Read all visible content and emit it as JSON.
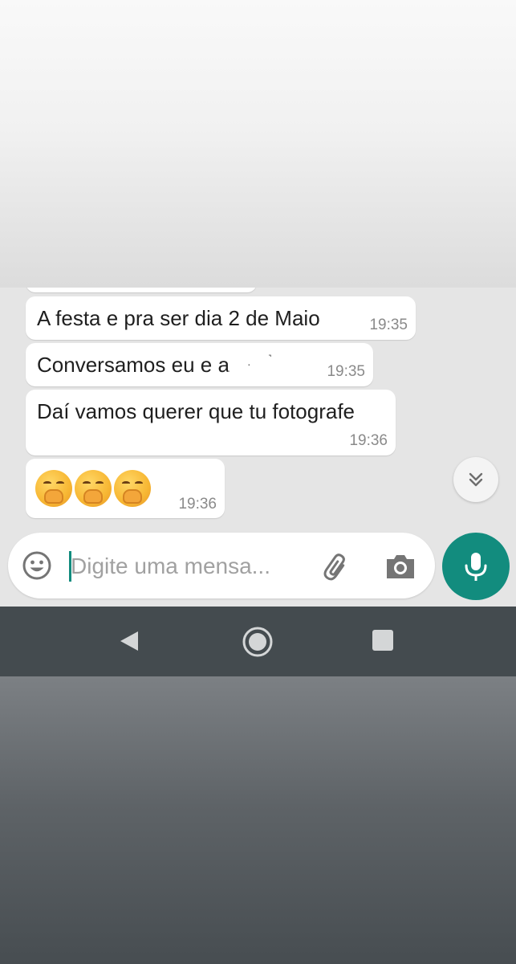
{
  "messages": [
    {
      "text": "A festa e pra ser dia 2 de Maio",
      "time": "19:35"
    },
    {
      "text": "Conversamos eu e a",
      "time": "19:35"
    },
    {
      "text": "Daí vamos querer que tu fotografe",
      "time": "19:36"
    },
    {
      "content": "shushing-face emoji ×3",
      "time": "19:36"
    }
  ],
  "input": {
    "placeholder": "Digite uma mensa..."
  },
  "icons": {
    "emoji": "smiley-icon",
    "attach": "paperclip-icon",
    "camera": "camera-icon",
    "mic": "microphone-icon",
    "scroll": "double-chevron-down-icon",
    "nav_back": "triangle-back-icon",
    "nav_home": "circle-home-icon",
    "nav_recent": "square-recent-icon"
  },
  "colors": {
    "accent": "#128c7e",
    "chat_background": "#e5e5e5",
    "bubble": "#ffffff",
    "nav_bar": "#444b4f"
  }
}
